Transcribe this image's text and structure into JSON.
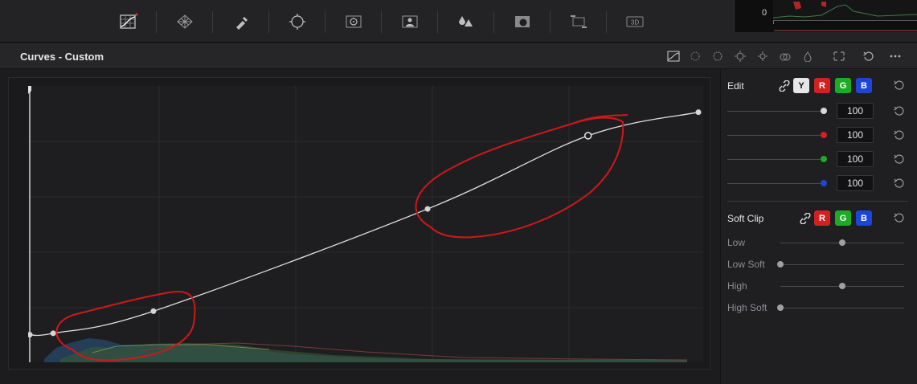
{
  "toolbar": {
    "tools": [
      {
        "icon": "curves-icon",
        "active": true
      },
      {
        "icon": "color-warper-icon"
      },
      {
        "icon": "qualifier-eyedropper-icon"
      },
      {
        "icon": "window-icon"
      },
      {
        "icon": "tracker-icon"
      },
      {
        "icon": "magic-mask-icon"
      },
      {
        "icon": "blur-icon"
      },
      {
        "icon": "key-icon"
      },
      {
        "icon": "sizing-icon"
      },
      {
        "icon": "3d-icon"
      }
    ],
    "tool_3d_label": "3D"
  },
  "preview": {
    "zero_label": "0"
  },
  "header": {
    "title": "Curves - Custom",
    "icons": [
      "curve-mode-icon",
      "hue-vs-hue-icon",
      "hue-vs-sat-icon",
      "hue-vs-lum-icon",
      "lum-vs-sat-icon",
      "sat-vs-sat-icon",
      "sat-vs-lum-icon",
      "expand-icon",
      "reset-icon",
      "more-options-icon"
    ]
  },
  "curve": {
    "points": [
      {
        "x": 0.0,
        "y": 0.1
      },
      {
        "x": 0.035,
        "y": 0.105
      },
      {
        "x": 0.185,
        "y": 0.185
      },
      {
        "x": 0.595,
        "y": 0.555
      },
      {
        "x": 0.835,
        "y": 0.82
      },
      {
        "x": 1.0,
        "y": 0.905
      }
    ],
    "accent": "#e0e0e0",
    "annotation_color": "#d01818"
  },
  "edit": {
    "label": "Edit",
    "channels": [
      {
        "label": "Y",
        "color": "#e6e6e6",
        "text": "#111"
      },
      {
        "label": "R",
        "color": "#d32020",
        "text": "#fff"
      },
      {
        "label": "G",
        "color": "#1faa26",
        "text": "#fff"
      },
      {
        "label": "B",
        "color": "#1d45d6",
        "text": "#fff"
      }
    ],
    "rows": [
      {
        "value": "100",
        "color": "#d8d8d8"
      },
      {
        "value": "100",
        "color": "#d32020"
      },
      {
        "value": "100",
        "color": "#1faa26"
      },
      {
        "value": "100",
        "color": "#1d45d6"
      }
    ]
  },
  "soft_clip": {
    "label": "Soft Clip",
    "channels": [
      {
        "label": "R",
        "color": "#d32020",
        "text": "#fff"
      },
      {
        "label": "G",
        "color": "#1faa26",
        "text": "#fff"
      },
      {
        "label": "B",
        "color": "#1d45d6",
        "text": "#fff"
      }
    ],
    "rows": [
      {
        "label": "Low",
        "level": 0.5
      },
      {
        "label": "Low Soft",
        "level": 0.0
      },
      {
        "label": "High",
        "level": 0.5
      },
      {
        "label": "High Soft",
        "level": 0.0
      }
    ]
  }
}
